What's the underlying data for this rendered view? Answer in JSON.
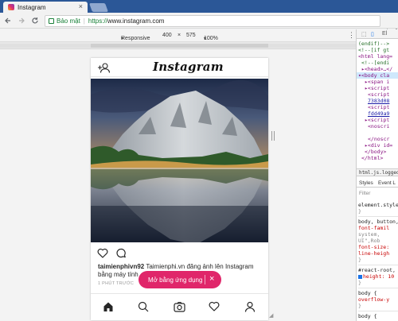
{
  "browser": {
    "tab_title": "Instagram",
    "tab_close": "×",
    "secure_label": "Bảo mật",
    "url_protocol": "https://",
    "url_host": "www.instagram.com"
  },
  "device_toolbar": {
    "device": "Responsive",
    "width": "400",
    "times": "×",
    "height": "575",
    "zoom": "100%"
  },
  "devtools": {
    "dom_lines": [
      {
        "text": "(endif)-->",
        "kind": "comment",
        "indent": 0
      },
      {
        "text": "<!--[if gt",
        "kind": "comment",
        "indent": 0
      },
      {
        "text": "<html lang=",
        "kind": "tag",
        "indent": 0
      },
      {
        "text": "<!--[endi",
        "kind": "comment",
        "indent": 1
      },
      {
        "text": "▸<head>…</",
        "kind": "tag",
        "indent": 1
      },
      {
        "text": "▾<body cla",
        "kind": "tag",
        "indent": 0,
        "selected": true
      },
      {
        "text": "▸<span i",
        "kind": "tag",
        "indent": 2
      },
      {
        "text": "▸<script",
        "kind": "tag",
        "indent": 2
      },
      {
        "text": "<script",
        "kind": "tag",
        "indent": 3
      },
      {
        "text": "7383d08",
        "kind": "link",
        "indent": 3
      },
      {
        "text": "<script",
        "kind": "tag",
        "indent": 3
      },
      {
        "text": "fdd49a9",
        "kind": "link",
        "indent": 3
      },
      {
        "text": "▸<script",
        "kind": "tag",
        "indent": 2
      },
      {
        "text": "<noscri",
        "kind": "tag",
        "indent": 3
      },
      {
        "text": "",
        "kind": "tag",
        "indent": 3
      },
      {
        "text": "</noscr",
        "kind": "tag",
        "indent": 3
      },
      {
        "text": "▸<div id=",
        "kind": "tag",
        "indent": 2
      },
      {
        "text": "</body>",
        "kind": "tag",
        "indent": 2
      },
      {
        "text": "</html>",
        "kind": "tag",
        "indent": 1
      }
    ],
    "breadcrumb": "html.js.logged-",
    "panel_tabs": [
      "Styles",
      "Event L"
    ],
    "filter_placeholder": "Filter",
    "styles": [
      {
        "text": "element.style",
        "kind": "selector"
      },
      {
        "text": "}",
        "kind": "plain"
      },
      {
        "sep": true
      },
      {
        "text": "body, button,",
        "kind": "selector"
      },
      {
        "text": "  font-famil",
        "kind": "prop"
      },
      {
        "text": "    system,",
        "kind": "plain"
      },
      {
        "text": "    UI\",Rob",
        "kind": "plain"
      },
      {
        "text": "  font-size:",
        "kind": "prop"
      },
      {
        "text": "  line-heigh",
        "kind": "prop"
      },
      {
        "text": "}",
        "kind": "plain"
      },
      {
        "sep": true
      },
      {
        "text": "#react-root,",
        "kind": "selector"
      },
      {
        "text": "height: 10",
        "kind": "prop",
        "checkbox": true
      },
      {
        "text": "}",
        "kind": "plain"
      },
      {
        "sep": true
      },
      {
        "text": "body {",
        "kind": "selector"
      },
      {
        "text": "  overflow-y",
        "kind": "prop"
      },
      {
        "text": "}",
        "kind": "plain"
      },
      {
        "sep": true
      },
      {
        "text": "body {",
        "kind": "selector"
      }
    ]
  },
  "instagram": {
    "logo": "Instagram",
    "caption_user": "taimienphivn92",
    "caption_text": " Taimienphi.vn đăng ảnh lên Instagram bằng máy tính",
    "timestamp": "1 PHÚT TRƯỚC",
    "open_app_label": "Mở bằng ứng dụng",
    "open_app_close": "×"
  },
  "colors": {
    "accent": "#e0266a",
    "secure_green": "#188038",
    "tabstrip": "#2b5797"
  },
  "icons": [
    "instagram-favicon",
    "back-icon",
    "forward-icon",
    "reload-icon",
    "home-icon",
    "lock-icon",
    "star-icon",
    "kebab-icon",
    "add-person-icon",
    "heart-icon",
    "comment-icon",
    "home-nav-icon",
    "search-icon",
    "camera-icon",
    "activity-heart-icon",
    "profile-icon",
    "inspect-icon",
    "device-icon"
  ]
}
